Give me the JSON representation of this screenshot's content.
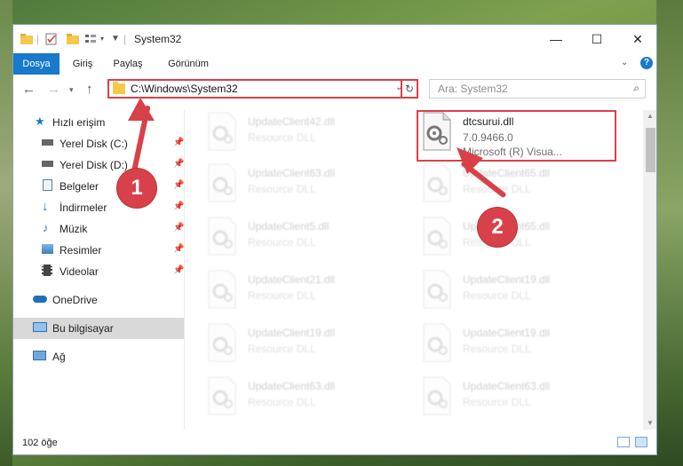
{
  "window": {
    "title": "System32"
  },
  "ribbon": {
    "tabs": [
      "Dosya",
      "Giriş",
      "Paylaş",
      "Görünüm"
    ]
  },
  "address": {
    "path": "C:\\Windows\\System32"
  },
  "search": {
    "placeholder": "Ara: System32"
  },
  "sidebar": {
    "quick_access": "Hızlı erişim",
    "items": [
      {
        "label": "Yerel Disk (C:)",
        "icon": "drive-icon",
        "pinned": true
      },
      {
        "label": "Yerel Disk (D:)",
        "icon": "drive-icon",
        "pinned": true
      },
      {
        "label": "Belgeler",
        "icon": "documents-icon",
        "pinned": true
      },
      {
        "label": "İndirmeler",
        "icon": "download-icon",
        "pinned": true
      },
      {
        "label": "Müzik",
        "icon": "music-icon",
        "pinned": true
      },
      {
        "label": "Resimler",
        "icon": "pictures-icon",
        "pinned": true
      },
      {
        "label": "Videolar",
        "icon": "videos-icon",
        "pinned": true
      }
    ],
    "onedrive": "OneDrive",
    "this_pc": "Bu bilgisayar",
    "network": "Ağ"
  },
  "files": {
    "highlighted": {
      "name": "dtcsurui.dll",
      "version": "7.0.9466.0",
      "company": "Microsoft (R) Visua..."
    },
    "left_column": [
      {
        "name": "UpdateClient42.dll",
        "type": "Resource DLL"
      },
      {
        "name": "UpdateClient63.dll",
        "type": "Resource DLL"
      },
      {
        "name": "UpdateClient5.dll",
        "type": "Resource DLL"
      },
      {
        "name": "UpdateClient21.dll",
        "type": "Resource DLL"
      },
      {
        "name": "UpdateClient19.dll",
        "type": "Resource DLL"
      },
      {
        "name": "UpdateClient63.dll",
        "type": "Resource DLL"
      }
    ],
    "right_column": [
      {
        "name": "UpdateClient65.dll",
        "type": "Resource DLL"
      },
      {
        "name": "UpdateClient65.dll",
        "type": "Resource DLL"
      },
      {
        "name": "UpdateClient19.dll",
        "type": "Resource DLL"
      },
      {
        "name": "UpdateClient19.dll",
        "type": "Resource DLL"
      },
      {
        "name": "UpdateClient63.dll",
        "type": "Resource DLL"
      }
    ]
  },
  "status": {
    "count": "102 öğe"
  },
  "annotations": {
    "one": "1",
    "two": "2"
  },
  "colors": {
    "accent": "#1979ca",
    "highlight": "#d9414a"
  }
}
